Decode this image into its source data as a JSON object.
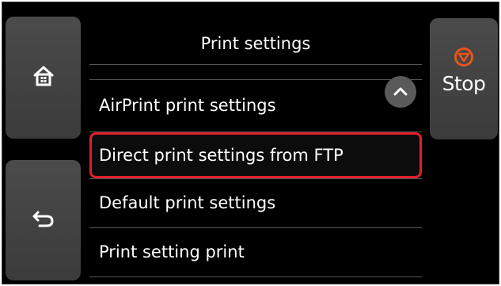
{
  "header": {
    "title": "Print settings"
  },
  "nav": {
    "home_icon": "home-icon",
    "back_icon": "back-arrow-icon"
  },
  "stop": {
    "label": "Stop",
    "icon": "stop-icon",
    "icon_color": "#e8541c"
  },
  "menu": {
    "items": [
      {
        "label": "AirPrint print settings",
        "selected": false
      },
      {
        "label": "Direct print settings from FTP",
        "selected": true
      },
      {
        "label": "Default print settings",
        "selected": false
      },
      {
        "label": "Print setting print",
        "selected": false
      }
    ],
    "selection_color": "#e0202a"
  },
  "scroll": {
    "icon": "chevron-up-icon"
  }
}
